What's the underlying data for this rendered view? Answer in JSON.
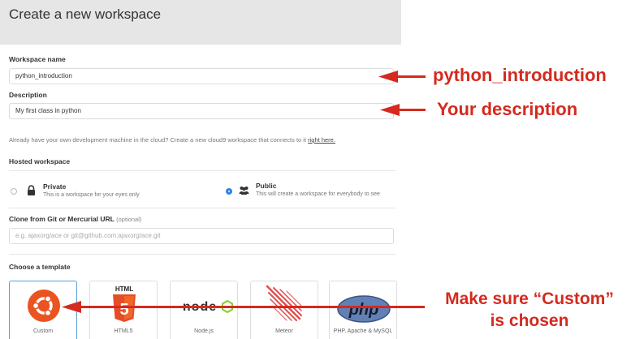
{
  "header": {
    "title": "Create a new workspace"
  },
  "form": {
    "name_label": "Workspace name",
    "name_value": "python_introduction",
    "desc_label": "Description",
    "desc_value": "My first class in python",
    "note_text": "Already have your own development machine in the cloud? Create a new cloud9 workspace that connects to it ",
    "note_link": "right here.",
    "hosted_label": "Hosted workspace",
    "private": {
      "title": "Private",
      "desc": "This is a workspace for your eyes only",
      "selected": false
    },
    "public": {
      "title": "Public",
      "desc": "This will create a workspace for everybody to see",
      "selected": true
    },
    "clone_label": "Clone from Git or Mercurial URL",
    "clone_optional": "(optional)",
    "clone_placeholder": "e.g. ajaxorg/ace or git@github.com:ajaxorg/ace.git",
    "template_label": "Choose a template"
  },
  "templates": [
    {
      "label": "Custom",
      "icon": "ubuntu-icon",
      "selected": true
    },
    {
      "label": "HTML5",
      "icon": "html5-icon",
      "icon_text": "HTML",
      "badge": "5"
    },
    {
      "label": "Node.js",
      "icon": "nodejs-icon",
      "icon_text": "node"
    },
    {
      "label": "Meteor",
      "icon": "meteor-icon"
    },
    {
      "label": "PHP, Apache & MySQL",
      "icon": "php-icon",
      "icon_text": "php"
    }
  ],
  "annotations": {
    "name": "python_introduction",
    "desc": "Your description",
    "custom_line1": "Make sure “Custom”",
    "custom_line2": "is chosen"
  },
  "colors": {
    "annotation": "#d42a1f",
    "accent": "#2d83e6",
    "header_bg": "#e6e6e6"
  }
}
